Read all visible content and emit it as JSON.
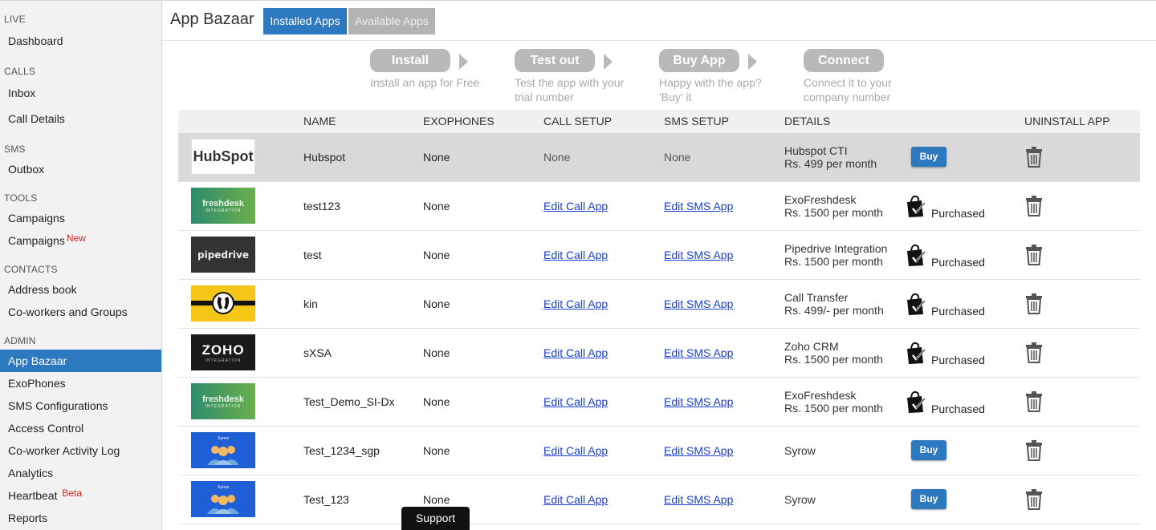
{
  "sidebar": {
    "sections": [
      {
        "title": "LIVE",
        "items": [
          {
            "label": "Dashboard"
          }
        ]
      },
      {
        "title": "CALLS",
        "items": [
          {
            "label": "Inbox"
          },
          {
            "label": "Call Details"
          }
        ]
      },
      {
        "title": "SMS",
        "items": [
          {
            "label": "Outbox"
          }
        ]
      },
      {
        "title": "TOOLS",
        "items": [
          {
            "label": "Campaigns"
          },
          {
            "label": "Campaigns",
            "tag": "New"
          }
        ]
      },
      {
        "title": "CONTACTS",
        "items": [
          {
            "label": "Address book"
          },
          {
            "label": "Co-workers and Groups"
          }
        ]
      },
      {
        "title": "ADMIN",
        "items": [
          {
            "label": "App Bazaar",
            "active": true
          },
          {
            "label": "ExoPhones"
          },
          {
            "label": "SMS Configurations"
          },
          {
            "label": "Access Control"
          },
          {
            "label": "Co-worker Activity Log"
          },
          {
            "label": "Analytics"
          },
          {
            "label": "Heartbeat",
            "tag": "Beta"
          },
          {
            "label": "Reports"
          }
        ]
      }
    ]
  },
  "header": {
    "title": "App Bazaar",
    "tabs": [
      {
        "label": "Installed Apps",
        "active": true
      },
      {
        "label": "Available Apps",
        "active": false
      }
    ]
  },
  "steps": [
    {
      "label": "Install",
      "desc": "Install an app for Free"
    },
    {
      "label": "Test out",
      "desc": "Test the app with your trial number"
    },
    {
      "label": "Buy App",
      "desc": "Happy with the app? 'Buy' it"
    },
    {
      "label": "Connect",
      "desc": "Connect it to your company number"
    }
  ],
  "table": {
    "headers": {
      "name": "NAME",
      "exophones": "EXOPHONES",
      "call_setup": "CALL SETUP",
      "sms_setup": "SMS SETUP",
      "details": "DETAILS",
      "uninstall": "UNINSTALL APP"
    },
    "rows": [
      {
        "logo": "HubSpot",
        "name": "Hubspot",
        "exophones": "None",
        "call_setup": "None",
        "sms_setup": "None",
        "details_line1": "Hubspot CTI",
        "details_line2": "Rs. 499 per month",
        "action": "Buy"
      },
      {
        "logo": "freshdesk",
        "logo_sub": "INTEGRATION",
        "name": "test123",
        "exophones": "None",
        "call_setup": "Edit Call App",
        "sms_setup": "Edit SMS App",
        "details_line1": "ExoFreshdesk",
        "details_line2": "Rs. 1500 per month",
        "action": "Purchased"
      },
      {
        "logo": "pipedrive",
        "name": "test",
        "exophones": "None",
        "call_setup": "Edit Call App",
        "sms_setup": "Edit SMS App",
        "details_line1": "Pipedrive Integration",
        "details_line2": "Rs. 1500 per month",
        "action": "Purchased"
      },
      {
        "logo": "",
        "name": "kin",
        "exophones": "None",
        "call_setup": "Edit Call App",
        "sms_setup": "Edit SMS App",
        "details_line1": "Call Transfer",
        "details_line2": "Rs. 499/- per month",
        "action": "Purchased"
      },
      {
        "logo": "ZOHO",
        "logo_sub": "INTEGRATION",
        "name": "sXSA",
        "exophones": "None",
        "call_setup": "Edit Call App",
        "sms_setup": "Edit SMS App",
        "details_line1": "Zoho CRM",
        "details_line2": "Rs. 1500 per month",
        "action": "Purchased"
      },
      {
        "logo": "freshdesk",
        "logo_sub": "INTEGRATION",
        "name": "Test_Demo_SI-Dx",
        "exophones": "None",
        "call_setup": "Edit Call App",
        "sms_setup": "Edit SMS App",
        "details_line1": "ExoFreshdesk",
        "details_line2": "Rs. 1500 per month",
        "action": "Purchased"
      },
      {
        "logo": "Syrow",
        "name": "Test_1234_sgp",
        "exophones": "None",
        "call_setup": "Edit Call App",
        "sms_setup": "Edit SMS App",
        "details_line1": "Syrow",
        "details_line2": "",
        "action": "Buy"
      },
      {
        "logo": "Syrow",
        "name": "Test_123",
        "exophones": "None",
        "call_setup": "Edit Call App",
        "sms_setup": "Edit SMS App",
        "details_line1": "Syrow",
        "details_line2": "",
        "action": "Buy"
      }
    ]
  },
  "support": {
    "label": "Support"
  },
  "colors": {
    "accent": "#2c79c0",
    "tag_red": "#e02020",
    "link": "#1a3fd6",
    "step_grey": "#b9b9b9"
  }
}
